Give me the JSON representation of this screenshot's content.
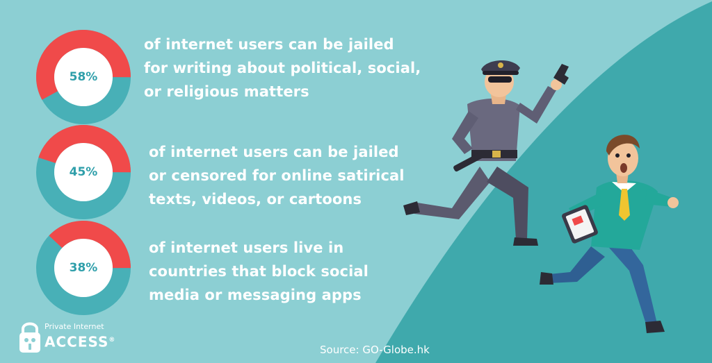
{
  "colors": {
    "background": "#8ccfd3",
    "background_dark": "#3fa9ac",
    "donut_filled": "#f04a4a",
    "donut_rest": "#48b0b7",
    "label": "#2f9faa",
    "text": "#ffffff"
  },
  "chart_data": {
    "type": "pie",
    "style": "donut",
    "slices_measured": "share of internet users",
    "items": [
      {
        "value": 58,
        "label": "58%",
        "lines": [
          "of internet users can be jailed",
          "for writing about political, social,",
          "or religious matters"
        ]
      },
      {
        "value": 45,
        "label": "45%",
        "lines": [
          "of internet users can be jailed",
          "or censored for online satirical",
          "texts, videos, or cartoons"
        ]
      },
      {
        "value": 38,
        "label": "38%",
        "lines": [
          "of internet users live in",
          "countries that block social",
          "media or messaging apps"
        ]
      }
    ]
  },
  "logo": {
    "line1": "Private Internet",
    "line2": "ACCESS",
    "mark": "®",
    "icon": "padlock-robot-icon"
  },
  "source": "Source: GO-Globe.hk",
  "illustration": {
    "figures": [
      "police-officer-with-gun",
      "man-running-with-phone"
    ]
  }
}
